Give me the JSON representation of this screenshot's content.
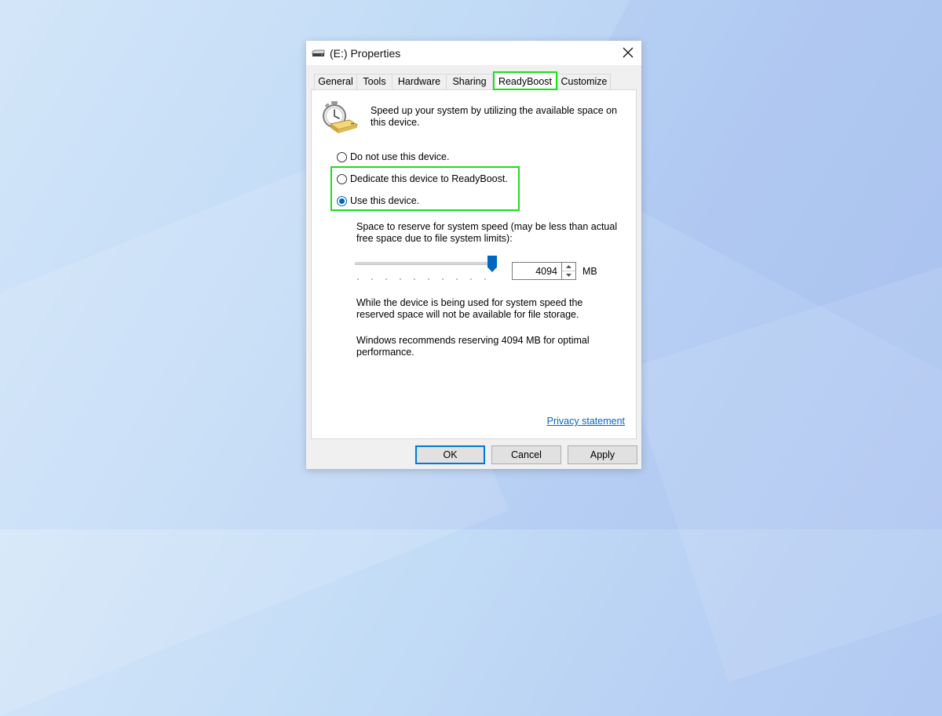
{
  "window": {
    "title": "(E:) Properties"
  },
  "tabs": [
    {
      "label": "General"
    },
    {
      "label": "Tools"
    },
    {
      "label": "Hardware"
    },
    {
      "label": "Sharing"
    },
    {
      "label": "ReadyBoost",
      "active": true
    },
    {
      "label": "Customize"
    }
  ],
  "readyboost": {
    "intro": "Speed up your system by utilizing the available space on this device.",
    "options": [
      {
        "label": "Do not use this device.",
        "checked": false
      },
      {
        "label": "Dedicate this device to ReadyBoost.",
        "checked": false
      },
      {
        "label": "Use this device.",
        "checked": true
      }
    ],
    "space_label": "Space to reserve for system speed (may be less than actual free space due to file system limits):",
    "reserve_value": "4094",
    "slider_level_percent": 95,
    "unit": "MB",
    "info_reserved": "While the device is being used for system speed the reserved space will not be available for file storage.",
    "info_recommend": "Windows recommends reserving 4094 MB for optimal performance.",
    "privacy_link": "Privacy statement"
  },
  "buttons": {
    "ok": "OK",
    "cancel": "Cancel",
    "apply": "Apply"
  },
  "colors": {
    "highlight": "#19e019",
    "accent": "#0067c0",
    "link": "#0066cc"
  },
  "icons": {
    "title": "drive-icon",
    "readyboost": "stopwatch-drive-icon",
    "close": "close-icon"
  }
}
